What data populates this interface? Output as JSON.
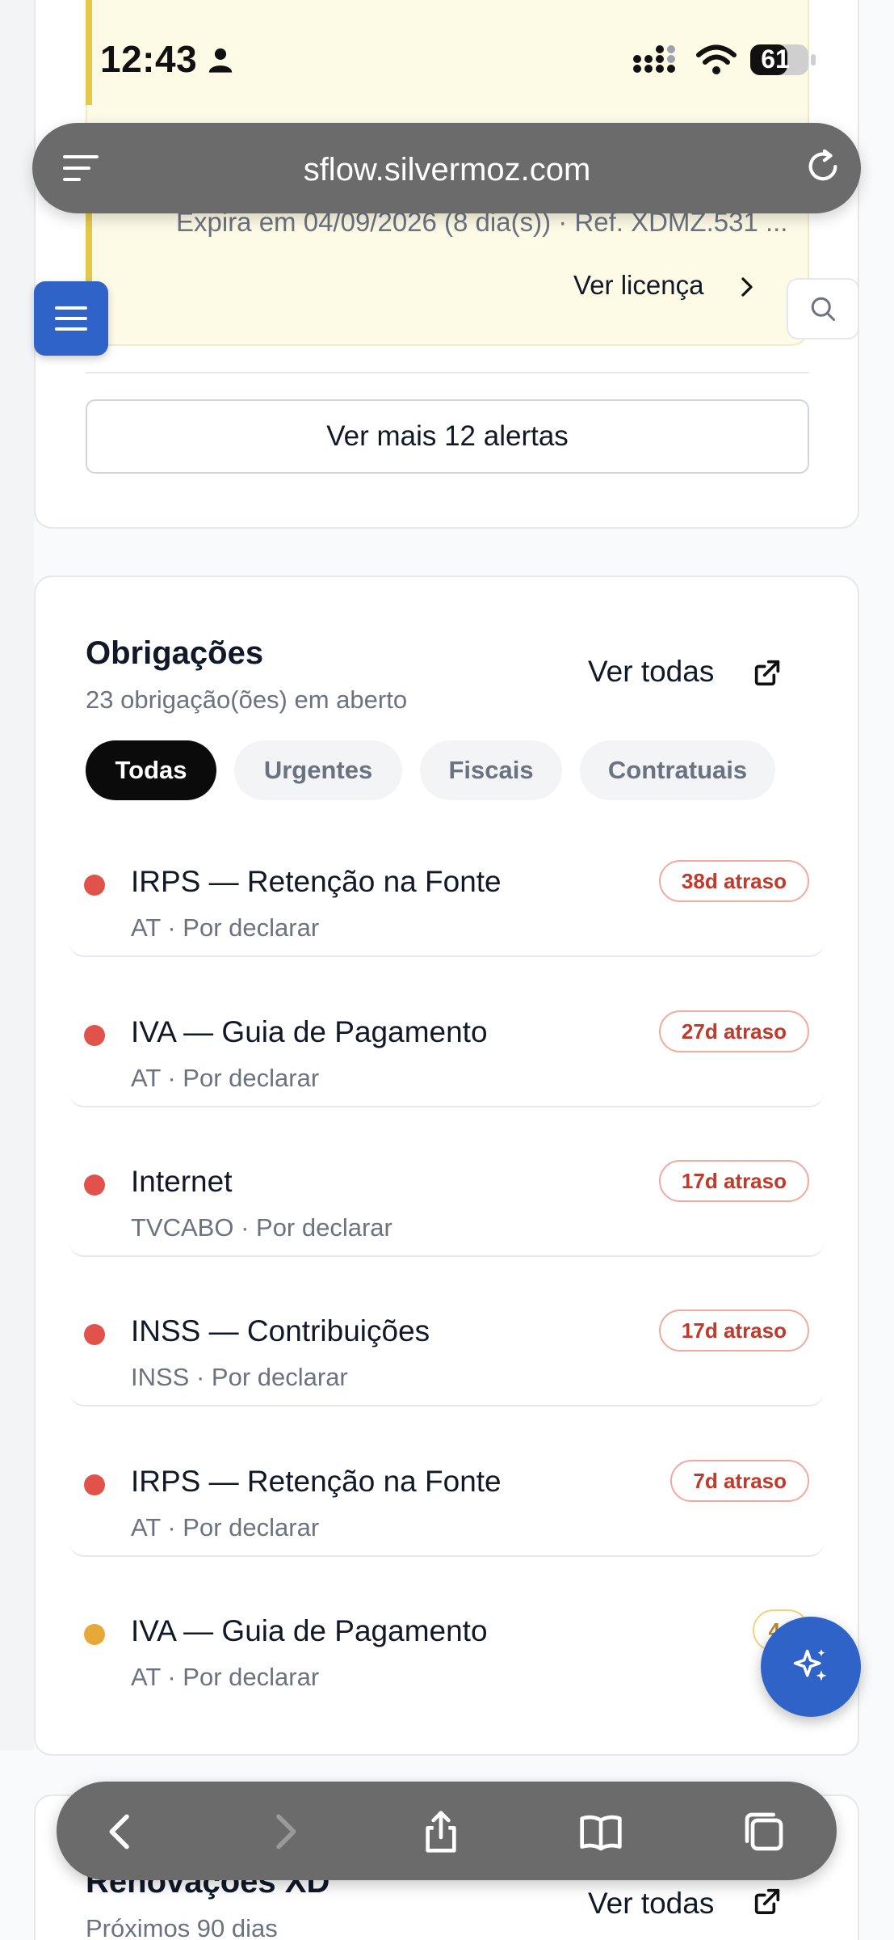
{
  "status_bar": {
    "time": "12:43",
    "battery": "61"
  },
  "browser": {
    "url": "sflow.silvermoz.com"
  },
  "license_alert": {
    "expira_text": "Expira em 04/09/2026 (8 dia(s)) · Ref. XDMZ.531 ...",
    "link_label": "Ver licença"
  },
  "alerts": {
    "more_button": "Ver mais 12 alertas"
  },
  "obrigacoes": {
    "title": "Obrigações",
    "subtitle": "23 obrigação(ões) em aberto",
    "view_all": "Ver todas",
    "filters": [
      "Todas",
      "Urgentes",
      "Fiscais",
      "Contratuais"
    ],
    "items": [
      {
        "name": "IRPS — Retenção na Fonte",
        "meta": "AT · Por declarar",
        "badge": "38d atraso",
        "status": "overdue"
      },
      {
        "name": "IVA — Guia de Pagamento",
        "meta": "AT · Por declarar",
        "badge": "27d atraso",
        "status": "overdue"
      },
      {
        "name": "Internet",
        "meta": "TVCABO · Por declarar",
        "badge": "17d atraso",
        "status": "overdue"
      },
      {
        "name": "INSS — Contribuições",
        "meta": "INSS · Por declarar",
        "badge": "17d atraso",
        "status": "overdue"
      },
      {
        "name": "IRPS — Retenção na Fonte",
        "meta": "AT · Por declarar",
        "badge": "7d atraso",
        "status": "overdue"
      },
      {
        "name": "IVA — Guia de Pagamento",
        "meta": "AT · Por declarar",
        "badge": "4d",
        "status": "soon"
      }
    ]
  },
  "renovacoes": {
    "title": "Renovações XD",
    "subtitle": "Próximos 90 dias",
    "view_all": "Ver todas"
  },
  "colors": {
    "accent": "#2f63c8",
    "overdue": "#e0524a",
    "soon": "#e8a838"
  },
  "icons": {
    "url_menu": "menu-icon",
    "url_reload": "reload-icon",
    "sidebar": "hamburger-icon",
    "search": "search-icon",
    "external": "external-link-icon",
    "fab": "sparkle-icon",
    "toolbar": [
      "back-icon",
      "forward-icon",
      "share-icon",
      "bookmarks-icon",
      "tabs-icon"
    ]
  }
}
